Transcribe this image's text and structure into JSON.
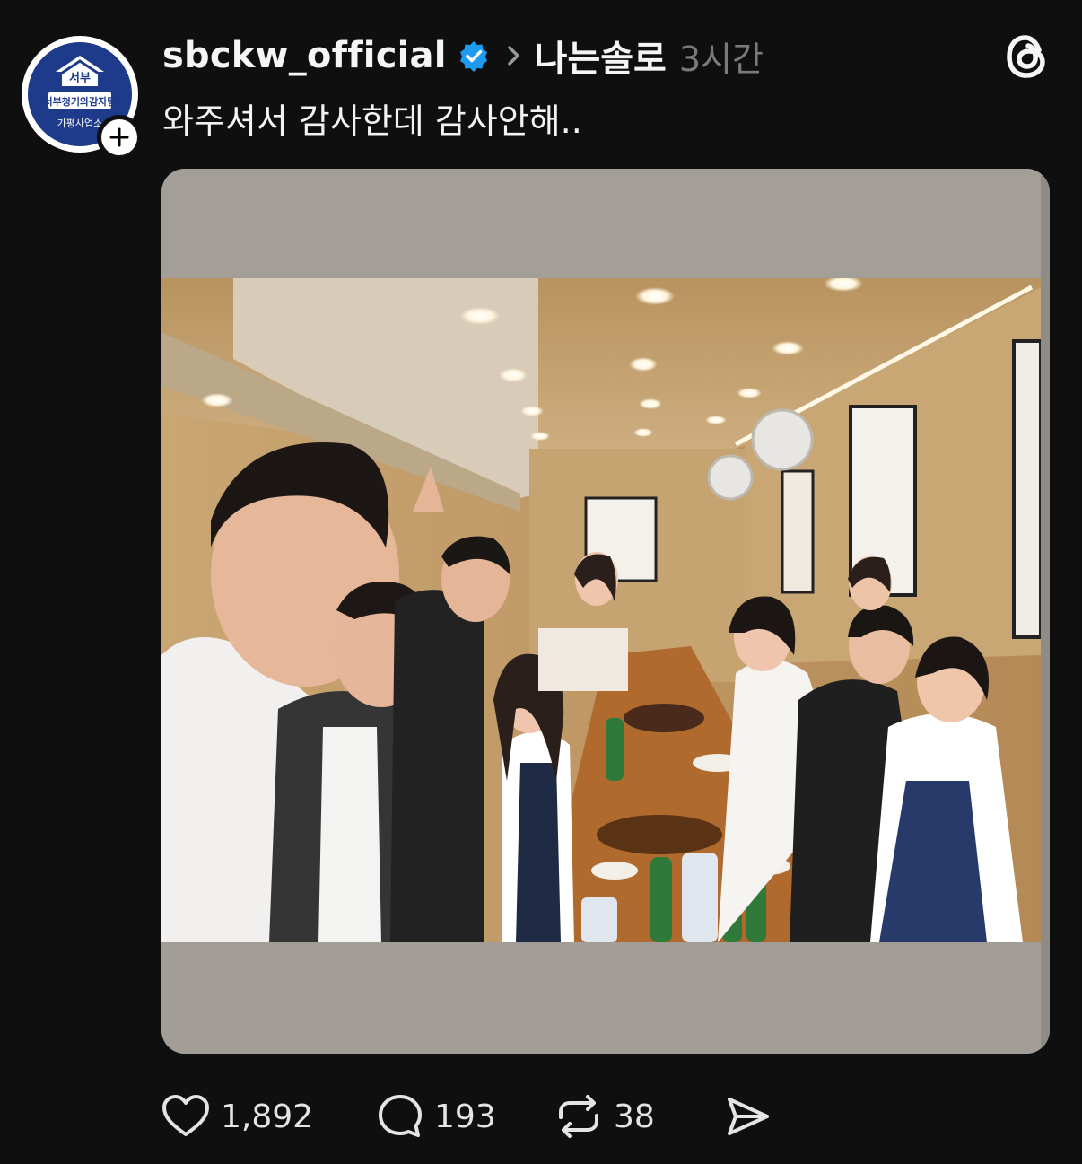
{
  "post": {
    "username": "sbckw_official",
    "topic": "나는솔로",
    "time": "3시간",
    "caption": "와주셔서 감사한데 감사안해..",
    "avatar_text_top": "서부",
    "avatar_text_mid": "서부청기와감자탕",
    "avatar_text_bottom": "가평사업소"
  },
  "actions": {
    "likes": "1,892",
    "replies": "193",
    "reposts": "38"
  },
  "icons": {
    "verified": "verified-badge-icon",
    "chevron": "chevron-right-icon",
    "threads": "threads-logo-icon",
    "like": "heart-icon",
    "reply": "comment-bubble-icon",
    "repost": "repost-icon",
    "share": "send-icon",
    "follow": "plus-icon"
  },
  "colors": {
    "background": "#0f0f0f",
    "verified": "#1d9bf0",
    "muted": "#7a7a7a",
    "avatar_navy": "#1e3a8a"
  }
}
